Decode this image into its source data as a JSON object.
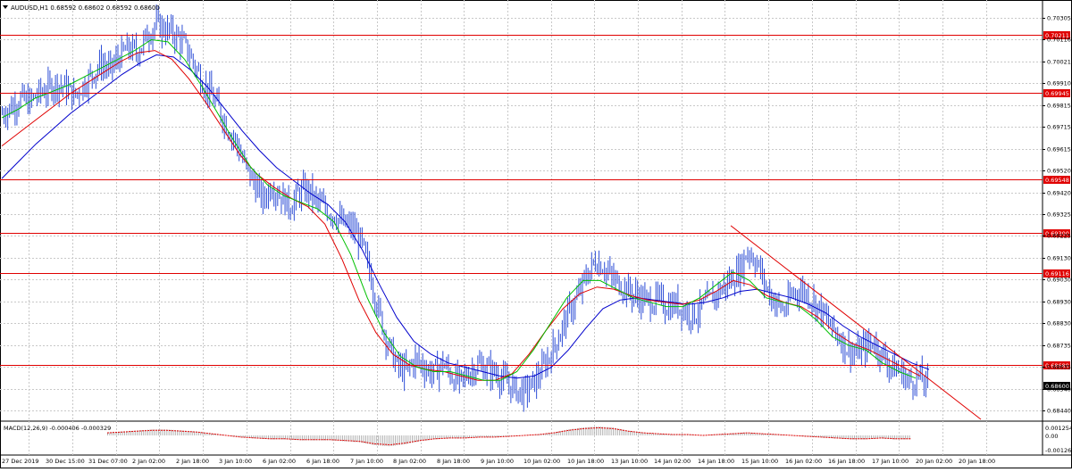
{
  "window": {
    "symbol_line": "AUDUSD,H1  0.68592 0.68602 0.68592 0.68600",
    "current_price_label": "0.68600"
  },
  "colors": {
    "background": "#ffffff",
    "frame": "#000000",
    "grid": "#c8c8c8",
    "candle": "#2f4fd6",
    "ma_fast": "#00c000",
    "ma_mid": "#e00000",
    "ma_slow": "#0000cc",
    "level_line": "#e00000",
    "level_label_bg": "#e00000",
    "current_label_bg": "#000000",
    "trendline": "#e00000",
    "macd_hist": "#b0b0b0",
    "macd_signal": "#e00000"
  },
  "price_axis": {
    "labels": [
      "0.70305",
      "0.70116",
      "0.70021",
      "0.69910",
      "0.69815",
      "0.69715",
      "0.69615",
      "0.69520",
      "0.69420",
      "0.69325",
      "0.69225",
      "0.69130",
      "0.69030",
      "0.68930",
      "0.68830",
      "0.68735",
      "0.68635",
      "0.68540",
      "0.68440"
    ]
  },
  "horizontal_levels": [
    {
      "label": "0.70211",
      "price": 0.70211
    },
    {
      "label": "0.69945",
      "price": 0.69945
    },
    {
      "label": "0.69548",
      "price": 0.69548
    },
    {
      "label": "0.69300",
      "price": 0.693
    },
    {
      "label": "0.69116",
      "price": 0.69116
    },
    {
      "label": "0.68689",
      "price": 0.68689
    }
  ],
  "time_axis": {
    "labels": [
      "27 Dec 2019",
      "30 Dec 15:00",
      "31 Dec 07:00",
      "2 Jan 02:00",
      "2 Jan 18:00",
      "3 Jan 10:00",
      "6 Jan 02:00",
      "6 Jan 18:00",
      "7 Jan 10:00",
      "8 Jan 02:00",
      "8 Jan 18:00",
      "9 Jan 10:00",
      "10 Jan 02:00",
      "10 Jan 18:00",
      "13 Jan 10:00",
      "14 Jan 02:00",
      "14 Jan 18:00",
      "15 Jan 10:00",
      "16 Jan 02:00",
      "16 Jan 18:00",
      "17 Jan 10:00",
      "20 Jan 02:00",
      "20 Jan 18:00"
    ]
  },
  "macd": {
    "label": "MACD(12,26,9) -0.000406 -0.000329",
    "axis_labels": [
      "0.001254",
      "0.00",
      "-0.00126"
    ]
  },
  "chart_data": {
    "type": "candlestick",
    "price_range": [
      0.6844,
      0.7034
    ],
    "closes": [
      0.6985,
      0.6988,
      0.6992,
      0.699,
      0.6994,
      0.6996,
      0.6999,
      0.6997,
      0.6993,
      0.6998,
      0.7003,
      0.7008,
      0.7005,
      0.7011,
      0.7015,
      0.7013,
      0.702,
      0.7026,
      0.7024,
      0.7022,
      0.7018,
      0.7011,
      0.7002,
      0.6995,
      0.6988,
      0.6979,
      0.6972,
      0.6961,
      0.6953,
      0.6945,
      0.6952,
      0.6947,
      0.6942,
      0.6948,
      0.695,
      0.6944,
      0.6941,
      0.6938,
      0.6934,
      0.6932,
      0.6925,
      0.691,
      0.6892,
      0.6878,
      0.6868,
      0.6866,
      0.6872,
      0.6868,
      0.6865,
      0.687,
      0.6864,
      0.6861,
      0.6866,
      0.6869,
      0.6867,
      0.6865,
      0.6861,
      0.6858,
      0.6856,
      0.686,
      0.6866,
      0.6874,
      0.6883,
      0.6893,
      0.69,
      0.691,
      0.6917,
      0.6914,
      0.6908,
      0.6906,
      0.6902,
      0.69,
      0.6898,
      0.6899,
      0.6896,
      0.6897,
      0.6894,
      0.6892,
      0.6896,
      0.69,
      0.6904,
      0.6908,
      0.6912,
      0.6922,
      0.6916,
      0.6905,
      0.6898,
      0.6894,
      0.6902,
      0.6904,
      0.69,
      0.6895,
      0.6888,
      0.6883,
      0.6877,
      0.6874,
      0.6877,
      0.688,
      0.6873,
      0.6868,
      0.6866,
      0.6861,
      0.6864,
      0.6859
    ],
    "ma_fast": [
      0.6983,
      0.6987,
      0.6992,
      0.6995,
      0.6998,
      0.7002,
      0.7006,
      0.701,
      0.7014,
      0.7019,
      0.7018,
      0.701,
      0.6998,
      0.6985,
      0.6972,
      0.696,
      0.6952,
      0.6947,
      0.6944,
      0.6941,
      0.6935,
      0.692,
      0.69,
      0.6884,
      0.6873,
      0.6868,
      0.6866,
      0.6866,
      0.6864,
      0.6862,
      0.6862,
      0.6866,
      0.6876,
      0.6888,
      0.69,
      0.6908,
      0.6908,
      0.6904,
      0.69,
      0.6898,
      0.6896,
      0.6896,
      0.69,
      0.6906,
      0.6912,
      0.6908,
      0.69,
      0.6898,
      0.6896,
      0.689,
      0.6882,
      0.6878,
      0.6876,
      0.687,
      0.6866,
      0.6863
    ],
    "ma_mid": [
      0.697,
      0.6976,
      0.6982,
      0.6988,
      0.6994,
      0.6999,
      0.7004,
      0.7009,
      0.7013,
      0.7014,
      0.701,
      0.7001,
      0.699,
      0.6978,
      0.6966,
      0.6957,
      0.6951,
      0.6946,
      0.6942,
      0.6934,
      0.6918,
      0.6899,
      0.6884,
      0.6874,
      0.6869,
      0.6867,
      0.6866,
      0.6864,
      0.6862,
      0.6862,
      0.6865,
      0.6874,
      0.6885,
      0.6895,
      0.6902,
      0.6905,
      0.6904,
      0.6901,
      0.6899,
      0.6898,
      0.6897,
      0.6899,
      0.6903,
      0.6908,
      0.6906,
      0.6901,
      0.6898,
      0.6896,
      0.6891,
      0.6884,
      0.6879,
      0.6876,
      0.6872,
      0.6868,
      0.6864
    ],
    "ma_slow": [
      0.6955,
      0.6963,
      0.6971,
      0.6978,
      0.6985,
      0.6991,
      0.6997,
      0.7003,
      0.7008,
      0.7012,
      0.7011,
      0.7005,
      0.6997,
      0.6987,
      0.6977,
      0.6968,
      0.696,
      0.6954,
      0.6948,
      0.6943,
      0.6935,
      0.6922,
      0.6906,
      0.6891,
      0.688,
      0.6874,
      0.687,
      0.6868,
      0.6866,
      0.6864,
      0.6863,
      0.6864,
      0.6868,
      0.6876,
      0.6886,
      0.6895,
      0.6899,
      0.69,
      0.6899,
      0.6898,
      0.6897,
      0.6898,
      0.69,
      0.6903,
      0.6904,
      0.6902,
      0.69,
      0.6897,
      0.6893,
      0.6887,
      0.6882,
      0.6878,
      0.6874,
      0.687,
      0.6867
    ],
    "trendline": [
      [
        0.693,
        0.6844
      ]
    ],
    "macd_hist": [
      0.0003,
      0.0004,
      0.0005,
      0.0006,
      0.0006,
      0.0005,
      0.0004,
      0.0002,
      0.0,
      -0.0002,
      -0.0003,
      -0.0004,
      -0.0004,
      -0.0005,
      -0.0005,
      -0.0005,
      -0.0006,
      -0.0007,
      -0.001,
      -0.0011,
      -0.0009,
      -0.0006,
      -0.0004,
      -0.0003,
      -0.0003,
      -0.0002,
      -0.0002,
      -0.0001,
      0.0,
      0.0001,
      0.0003,
      0.0006,
      0.0008,
      0.0009,
      0.0008,
      0.0005,
      0.0003,
      0.0002,
      0.0001,
      0.0001,
      0.0,
      0.0001,
      0.0002,
      0.0003,
      0.0002,
      0.0001,
      0.0,
      -0.0001,
      -0.0002,
      -0.0003,
      -0.0004,
      -0.0004,
      -0.0003,
      -0.0004,
      -0.0004
    ]
  }
}
